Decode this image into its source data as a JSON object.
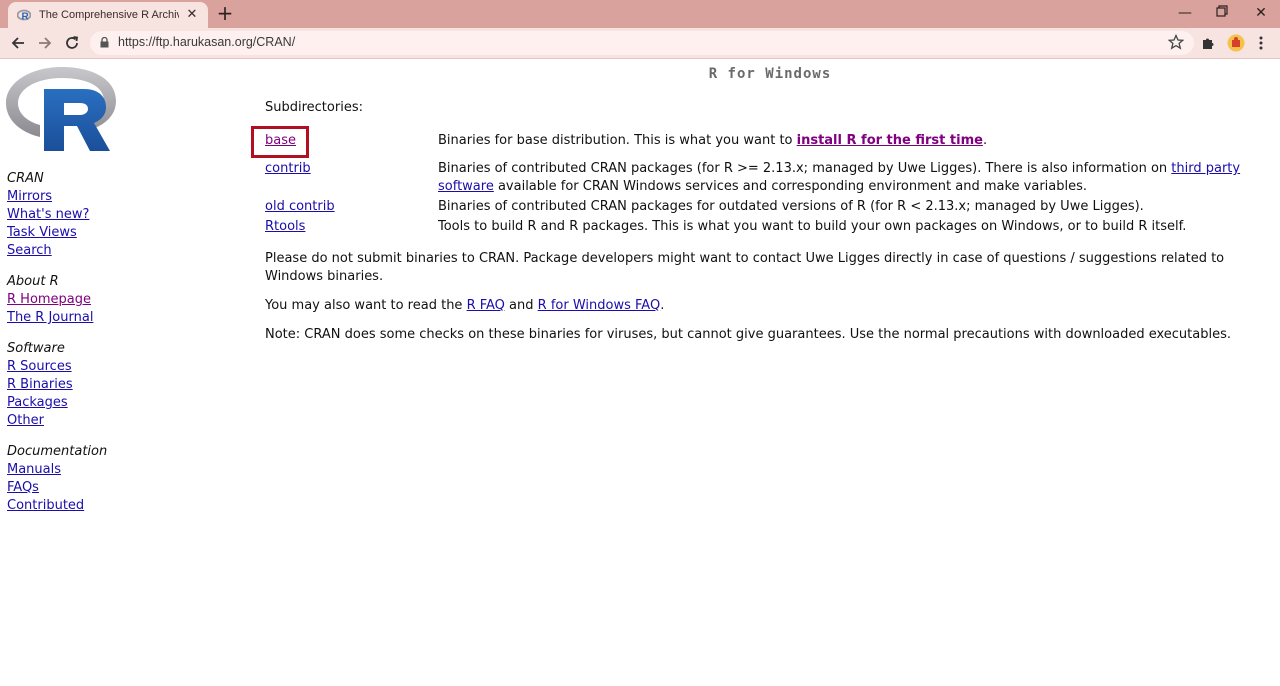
{
  "browser": {
    "tab_title": "The Comprehensive R Archive N",
    "url": "https://ftp.harukasan.org/CRAN/"
  },
  "page": {
    "heading": "R for Windows",
    "subdirectories_label": "Subdirectories:",
    "subdirs": [
      {
        "name": "base",
        "desc_before": "Binaries for base distribution. This is what you want to ",
        "desc_link": "install R for the first time",
        "desc_after": "."
      },
      {
        "name": "contrib",
        "desc_before": "Binaries of contributed CRAN packages (for R >= 2.13.x; managed by Uwe Ligges). There is also information on ",
        "desc_link": "third party software",
        "desc_after": " available for CRAN Windows services and corresponding environment and make variables."
      },
      {
        "name": "old contrib",
        "desc": "Binaries of contributed CRAN packages for outdated versions of R (for R < 2.13.x; managed by Uwe Ligges)."
      },
      {
        "name": "Rtools",
        "desc": "Tools to build R and R packages. This is what you want to build your own packages on Windows, or to build R itself."
      }
    ],
    "note1": "Please do not submit binaries to CRAN. Package developers might want to contact Uwe Ligges directly in case of questions / suggestions related to Windows binaries.",
    "note2_before": "You may also want to read the ",
    "note2_link1": "R FAQ",
    "note2_mid": " and ",
    "note2_link2": "R for Windows FAQ",
    "note2_after": ".",
    "note3": "Note: CRAN does some checks on these binaries for viruses, but cannot give guarantees. Use the normal precautions with downloaded executables."
  },
  "sidebar": {
    "cran": {
      "title": "CRAN",
      "links": [
        "Mirrors",
        "What's new?",
        "Task Views",
        "Search"
      ]
    },
    "about": {
      "title": "About R",
      "links": [
        "R Homepage",
        "The R Journal"
      ]
    },
    "software": {
      "title": "Software",
      "links": [
        "R Sources",
        "R Binaries",
        "Packages",
        "Other"
      ]
    },
    "documentation": {
      "title": "Documentation",
      "links": [
        "Manuals",
        "FAQs",
        "Contributed"
      ]
    }
  },
  "colors": {
    "tabbar": "#daa29c",
    "toolbar": "#f7e3e0",
    "link": "#1a0dab",
    "visited_link": "#800080",
    "highlight_box": "#b01020"
  }
}
